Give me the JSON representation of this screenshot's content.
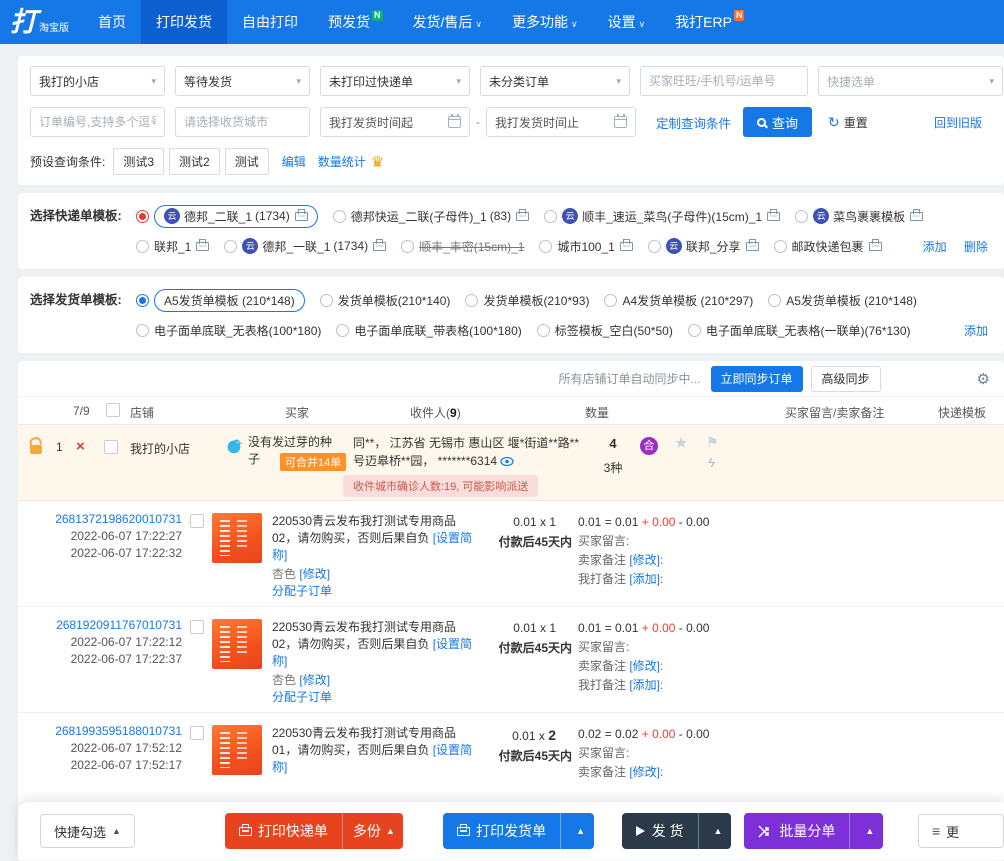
{
  "icons": {
    "cloud": "云",
    "merge": "合",
    "caret": "▾",
    "up": "▲",
    "down": "∨",
    "gear": "⚙",
    "reset": "↻",
    "crown": "♛",
    "star": "★",
    "flag": "⚑",
    "bolt": "ϟ",
    "close": "×",
    "list": "≡",
    "dash": "-"
  },
  "nav": {
    "logo_main": "打",
    "logo_sub": "淘宝版",
    "items": [
      {
        "label": "首页"
      },
      {
        "label": "打印发货"
      },
      {
        "label": "自由打印"
      },
      {
        "label": "预发货",
        "badge": "N"
      },
      {
        "label": "发货/售后"
      },
      {
        "label": "更多功能"
      },
      {
        "label": "设置"
      },
      {
        "label": "我打ERP",
        "badge": "N"
      }
    ]
  },
  "filters": {
    "shop": "我打的小店",
    "status": "等待发货",
    "print_state": "未打印过快递单",
    "category": "未分类订单",
    "search_placeholder": "买家旺旺/手机号/运单号",
    "quick_select": "快捷选单",
    "order_no_placeholder": "订单编号,支持多个逗号",
    "city_placeholder": "请选择收货城市",
    "time_start": "我打发货时间起",
    "time_end": "我打发货时间止",
    "custom_query": "定制查询条件",
    "search": "查询",
    "reset": "重置",
    "back_old": "回到旧版",
    "preset_label": "预设查询条件:",
    "presets": [
      "测试3",
      "测试2",
      "测试"
    ],
    "edit": "编辑",
    "stats": "数量统计"
  },
  "express_templates": {
    "label": "选择快递单模板:",
    "row1": [
      {
        "name": "德邦_二联_1",
        "count": "(1734)"
      },
      {
        "name": "德邦快运_二联(子母件)_1",
        "count": "(83)"
      },
      {
        "name": "顺丰_速运_菜鸟(子母件)(15cm)_1",
        "count": ""
      },
      {
        "name": "菜鸟裹裹模板",
        "count": ""
      }
    ],
    "row2": [
      {
        "name": "联邦_1",
        "count": ""
      },
      {
        "name": "德邦_一联_1",
        "count": "(1734)"
      },
      {
        "name": "顺丰_丰密(15cm)_1",
        "count": ""
      },
      {
        "name": "城市100_1",
        "count": ""
      },
      {
        "name": "联邦_分享",
        "count": ""
      },
      {
        "name": "邮政快递包裹",
        "count": ""
      }
    ],
    "add": "添加",
    "remove": "删除"
  },
  "invoice_templates": {
    "label": "选择发货单模板:",
    "row1": [
      "A5发货单模板 (210*148)",
      "发货单模板(210*140)",
      "发货单模板(210*93)",
      "A4发货单模板 (210*297)",
      "A5发货单模板 (210*148)"
    ],
    "row2": [
      "电子面单底联_无表格(100*180)",
      "电子面单底联_带表格(100*180)",
      "标签模板_空白(50*50)",
      "电子面单底联_无表格(一联单)(76*130)"
    ],
    "add": "添加"
  },
  "sync": {
    "status": "所有店铺订单自动同步中...",
    "sync_now": "立即同步订单",
    "advanced": "高级同步"
  },
  "table": {
    "count": "7/9",
    "shop": "店铺",
    "buyer": "买家",
    "receiver_prefix": "收件人(",
    "receiver_count": "9",
    "receiver_suffix": ")",
    "qty": "数量",
    "notes": "买家留言/卖家备注",
    "express": "快递模板"
  },
  "group": {
    "index": "1",
    "shop": "我打的小店",
    "buyer": "没有发过芽的种子",
    "merge_badge": "可合并14单",
    "receiver_line1": "同**， 江苏省 无锡市 惠山区 堰*街道**路**",
    "receiver_line2": "号迈皋桥**园， *******6314",
    "qty": "4",
    "kinds": "3种",
    "warning": "收件城市确诊人数:19, 可能影响派送"
  },
  "orders": [
    {
      "id": "2681372198620010731",
      "created": "2022-06-07 17:22:27",
      "paid": "2022-06-07 17:22:32",
      "title": "220530青云发布我打测试专用商品02，请勿购买，否则后果自负",
      "short_link": "[设置简称]",
      "sku": "杏色",
      "sku_modify": "[修改]",
      "assign": "分配子订单",
      "price": "0.01 x ",
      "qty": "1",
      "term": "付款后45天内",
      "total_prefix": "0.01 = 0.01 ",
      "total_red": "+ 0.00",
      "total_suffix": " - 0.00",
      "buyer_msg": "买家留言:",
      "seller_label": "卖家备注 ",
      "seller_modify": "[修改]",
      "seller_colon": ":",
      "mine_label": "我打备注 ",
      "mine_add": "[添加]",
      "mine_colon": ":"
    },
    {
      "id": "2681920911767010731",
      "created": "2022-06-07 17:22:12",
      "paid": "2022-06-07 17:22:37",
      "title": "220530青云发布我打测试专用商品02，请勿购买，否则后果自负",
      "short_link": "[设置简称]",
      "sku": "杏色",
      "sku_modify": "[修改]",
      "assign": "分配子订单",
      "price": "0.01 x ",
      "qty": "1",
      "term": "付款后45天内",
      "total_prefix": "0.01 = 0.01 ",
      "total_red": "+ 0.00",
      "total_suffix": " - 0.00",
      "buyer_msg": "买家留言:",
      "seller_label": "卖家备注 ",
      "seller_modify": "[修改]",
      "seller_colon": ":",
      "mine_label": "我打备注 ",
      "mine_add": "[添加]",
      "mine_colon": ":"
    },
    {
      "id": "2681993595188010731",
      "created": "2022-06-07 17:52:12",
      "paid": "2022-06-07 17:52:17",
      "title": "220530青云发布我打测试专用商品01，请勿购买，否则后果自负",
      "short_link": "[设置简称]",
      "sku": "",
      "sku_modify": "",
      "assign": "",
      "price": "0.01 x ",
      "qty": "2",
      "term": "付款后45天内",
      "total_prefix": "0.02 = 0.02 ",
      "total_red": "+ 0.00",
      "total_suffix": " - 0.00",
      "buyer_msg": "买家留言:",
      "seller_label": "卖家备注 ",
      "seller_modify": "[修改]",
      "seller_colon": ":",
      "mine_label": "",
      "mine_add": "",
      "mine_colon": ""
    }
  ],
  "bottom": {
    "quick": "快捷勾选",
    "print_express": "打印快递单",
    "multi": "多份",
    "print_invoice": "打印发货单",
    "ship": "发 货",
    "split": "批量分单",
    "more": "更"
  }
}
